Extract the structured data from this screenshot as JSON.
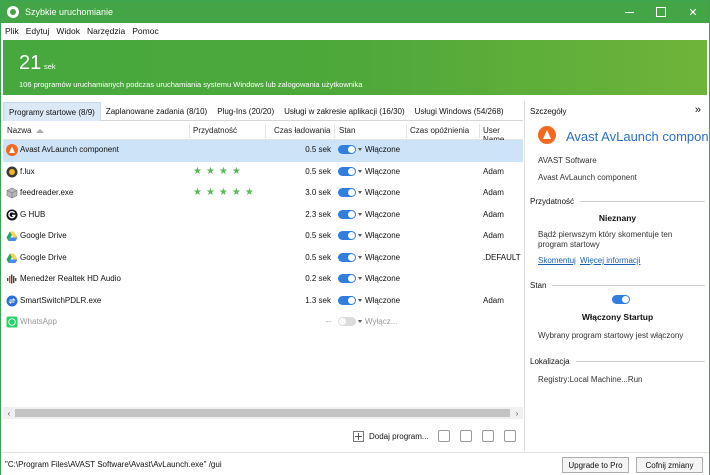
{
  "window": {
    "title": "Szybkie uruchomianie"
  },
  "menu": [
    "Plik",
    "Edytuj",
    "Widok",
    "Narzędzia",
    "Pomoc"
  ],
  "banner": {
    "seconds": "21",
    "unit": "sek",
    "description": "106 programów uruchamianych podczas uruchamiania systemu Windows lub zalogowania użytkownika"
  },
  "tabs": [
    "Programy startowe (8/9)",
    "Zaplanowane zadania (8/10)",
    "Plug-Ins (20/20)",
    "Usługi w zakresie aplikacji (16/30)",
    "Usługi Windows (54/268)"
  ],
  "columns": {
    "name": "Nazwa",
    "rating": "Przydatność",
    "load_time": "Czas ładowania",
    "state": "Stan",
    "delay": "Czas opóźnienia",
    "user": "User Name"
  },
  "rows": [
    {
      "name": "Avast AvLaunch component",
      "rating": 0,
      "time": "0.5 sek",
      "state": "Włączone",
      "user": "",
      "icon": "avast-icon",
      "selected": true,
      "enabled": true
    },
    {
      "name": "f.lux",
      "rating": 4,
      "time": "0.5 sek",
      "state": "Włączone",
      "user": "Adam",
      "icon": "flux-icon",
      "enabled": true
    },
    {
      "name": "feedreader.exe",
      "rating": 5,
      "time": "3.0 sek",
      "state": "Włączone",
      "user": "Adam",
      "icon": "package-icon",
      "enabled": true
    },
    {
      "name": "G HUB",
      "rating": 0,
      "time": "2.3 sek",
      "state": "Włączone",
      "user": "Adam",
      "icon": "ghub-icon",
      "enabled": true
    },
    {
      "name": "Google Drive",
      "rating": 0,
      "time": "0.5 sek",
      "state": "Włączone",
      "user": "Adam",
      "icon": "google-drive-icon",
      "enabled": true
    },
    {
      "name": "Google Drive",
      "rating": 0,
      "time": "0.5 sek",
      "state": "Włączone",
      "user": ".DEFAULT",
      "icon": "google-drive-icon",
      "enabled": true
    },
    {
      "name": "Menedżer Realtek HD Audio",
      "rating": 0,
      "time": "0.2 sek",
      "state": "Włączone",
      "user": "",
      "icon": "audio-icon",
      "enabled": true
    },
    {
      "name": "SmartSwitchPDLR.exe",
      "rating": 0,
      "time": "1.3 sek",
      "state": "Włączone",
      "user": "Adam",
      "icon": "smartswitch-icon",
      "enabled": true
    },
    {
      "name": "WhatsApp",
      "rating": 0,
      "time": "--",
      "state": "Wyłącz...",
      "user": "",
      "icon": "whatsapp-icon",
      "enabled": false
    }
  ],
  "toolbar": {
    "add_label": "Dodaj program..."
  },
  "details": {
    "header": "Szczegóły",
    "expand": "»",
    "title": "Avast AvLaunch compon...",
    "vendor": "AVAST Software",
    "product": "Avast AvLaunch component",
    "rating_section": "Przydatność",
    "rating_value": "Nieznany",
    "rating_note": "Bądź pierwszym który skomentuje ten program startowy",
    "link_comment": "Skomentuj",
    "link_more": "Więcej informacji",
    "state_section": "Stan",
    "state_value": "Włączony Startup",
    "state_note": "Wybrany program startowy jest włączony",
    "location_section": "Lokalizacja",
    "location_value": "Registry:Local Machine...Run"
  },
  "status": {
    "path": "\"C:\\Program Files\\AVAST Software\\Avast\\AvLaunch.exe\" /gui",
    "upgrade_button": "Upgrade to Pro",
    "undo_button": "Cofnij zmiany"
  },
  "colors": {
    "accent": "#43a545",
    "link": "#1a5fb4",
    "toggle_on": "#2f7ee0",
    "star": "#5cb85c"
  }
}
